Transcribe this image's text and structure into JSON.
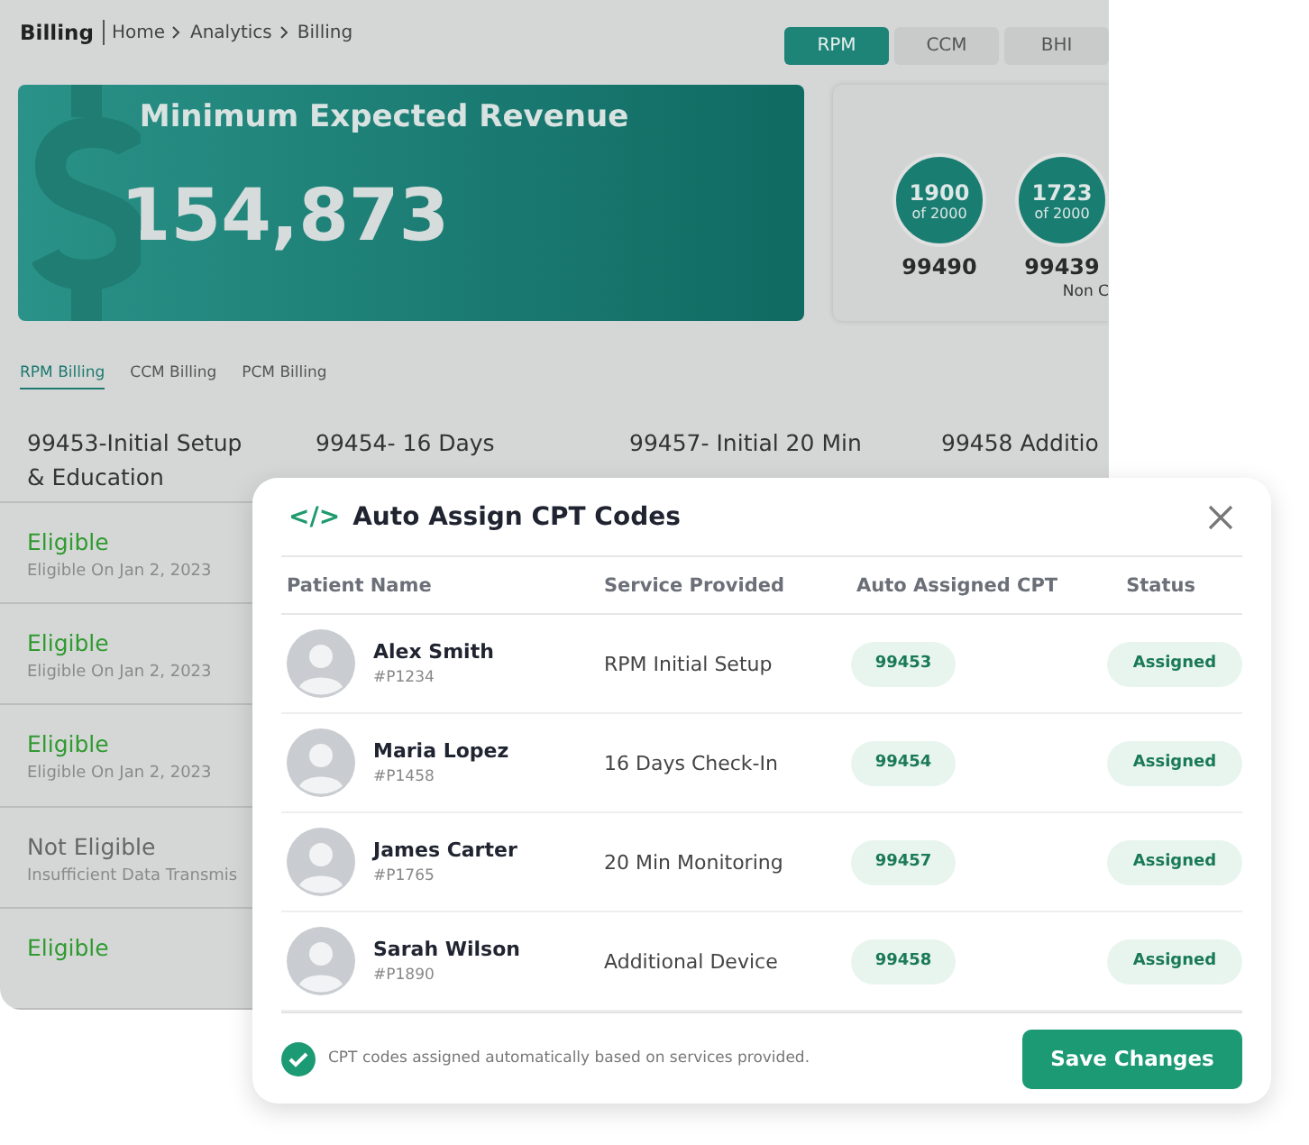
{
  "header": {
    "title": "Billing",
    "breadcrumb": [
      "Home",
      "Analytics",
      "Billing"
    ]
  },
  "program_tabs": [
    {
      "label": "RPM",
      "selected": true
    },
    {
      "label": "CCM",
      "selected": false
    },
    {
      "label": "BHI",
      "selected": false
    }
  ],
  "revenue_card": {
    "title": "Minimum Expected Revenue",
    "value": "154,873"
  },
  "stats_card": {
    "items": [
      {
        "count": "1900",
        "of": "of 2000",
        "code": "99490"
      },
      {
        "count": "1723",
        "of": "of 2000",
        "code": "99439"
      }
    ],
    "note": "Non C"
  },
  "billing_tabs": [
    {
      "label": "RPM Billing",
      "selected": true
    },
    {
      "label": "CCM Billing",
      "selected": false
    },
    {
      "label": "PCM Billing",
      "selected": false
    }
  ],
  "billing_columns": [
    "99453-Initial Setup & Education",
    "99454- 16 Days",
    "99457- Initial 20 Min",
    "99458 Additio"
  ],
  "billing_rows": [
    {
      "status": "Eligible",
      "eligible": true,
      "detail": "Eligible On Jan 2, 2023"
    },
    {
      "status": "Eligible",
      "eligible": true,
      "detail": "Eligible On Jan 2, 2023"
    },
    {
      "status": "Eligible",
      "eligible": true,
      "detail": "Eligible On Jan 2, 2023"
    },
    {
      "status": "Not Eligible",
      "eligible": false,
      "detail": "Insufficient Data Transmis"
    },
    {
      "status": "Eligible",
      "eligible": true
    }
  ],
  "modal": {
    "title": "Auto Assign CPT Codes",
    "title_icon": "</>",
    "columns": [
      "Patient Name",
      "Service Provided",
      "Auto Assigned CPT",
      "Status"
    ],
    "rows": [
      {
        "name": "Alex Smith",
        "id": "#P1234",
        "service": "RPM Initial Setup",
        "cpt": "99453",
        "status": "Assigned"
      },
      {
        "name": "Maria Lopez",
        "id": "#P1458",
        "service": "16 Days Check-In",
        "cpt": "99454",
        "status": "Assigned"
      },
      {
        "name": "James Carter",
        "id": "#P1765",
        "service": "20 Min Monitoring",
        "cpt": "99457",
        "status": "Assigned"
      },
      {
        "name": "Sarah Wilson",
        "id": "#P1890",
        "service": "Additional Device",
        "cpt": "99458",
        "status": "Assigned"
      }
    ],
    "footer_note": "CPT codes assigned automatically based on services provided.",
    "save_button": "Save Changes"
  }
}
